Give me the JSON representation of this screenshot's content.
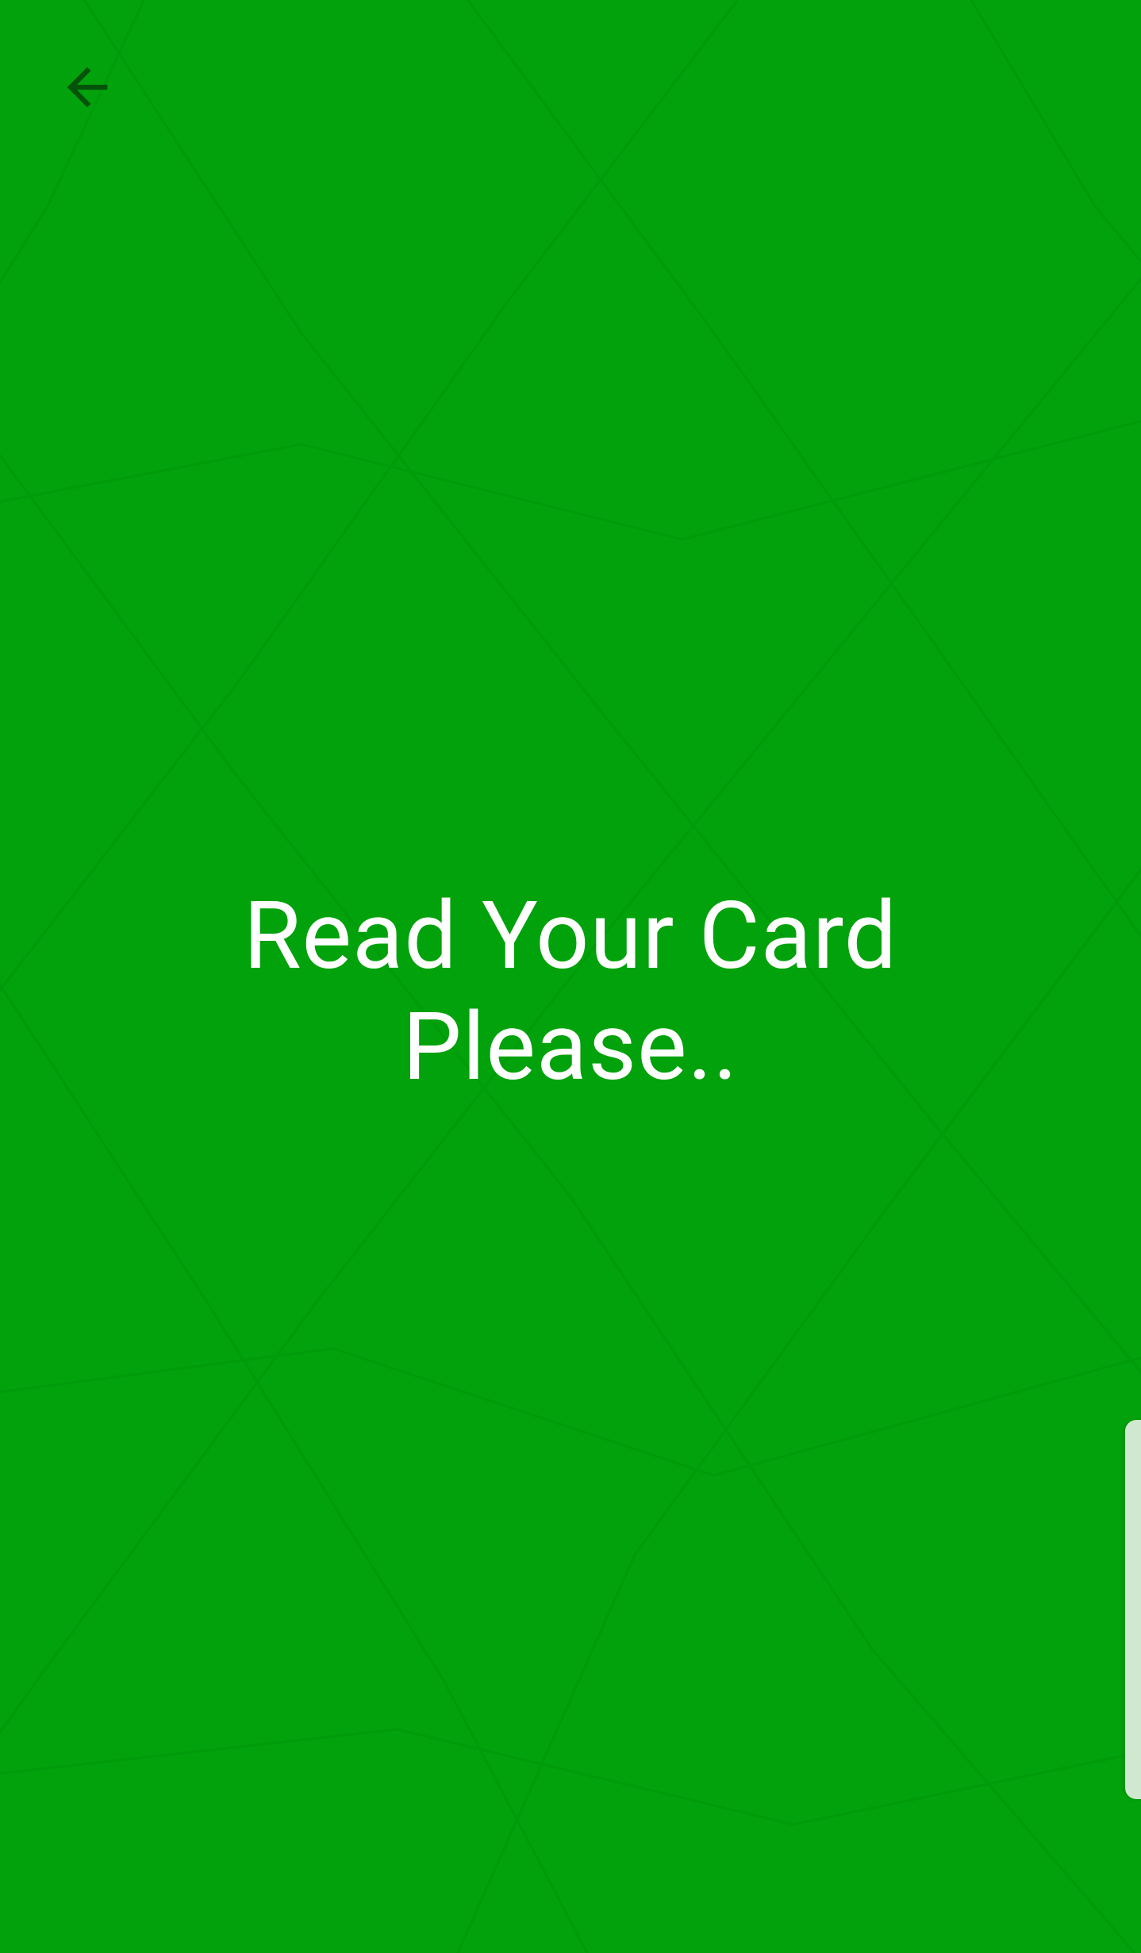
{
  "screen": {
    "background_color": "#01a20b",
    "text_color": "#ffffff",
    "icon_color": "#05520a"
  },
  "toolbar": {
    "back_icon": "arrow-left-icon"
  },
  "message": {
    "line1": "Read Your Card",
    "line2": "Please.."
  },
  "edge_panel": {
    "color": "#cfe8cf"
  }
}
